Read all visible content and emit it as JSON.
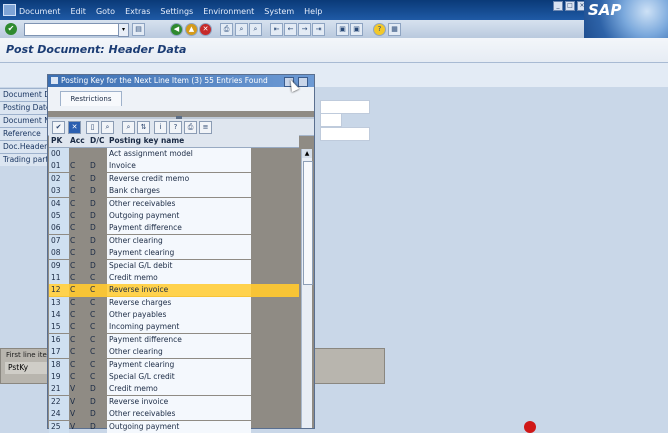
{
  "menu": {
    "items": [
      "Document",
      "Edit",
      "Goto",
      "Extras",
      "Settings",
      "Environment",
      "System",
      "Help"
    ],
    "logo": "SAP"
  },
  "toolbar": {
    "command_value": "",
    "icons": [
      "enter-icon",
      "save-icon",
      "back-icon",
      "exit-icon",
      "cancel-icon",
      "print-icon",
      "find-icon",
      "find-next-icon",
      "first-page-icon",
      "prev-page-icon",
      "next-page-icon",
      "last-page-icon",
      "new-session-icon",
      "shortcut-icon",
      "help-icon",
      "layout-icon"
    ]
  },
  "page": {
    "title": "Post Document: Header Data"
  },
  "header_labels": [
    "Document D",
    "Posting Date",
    "Document N",
    "Reference",
    "Doc.Header",
    "Trading part"
  ],
  "first_line": {
    "title": "First line ite",
    "pstky_label": "PstKy",
    "pstky_value": "1"
  },
  "dialog": {
    "title": "Posting Key for the Next Line Item (3)   55 Entries Found",
    "tab": "Restrictions",
    "columns": {
      "pk": "PK",
      "acc": "Acc",
      "dc": "D/C",
      "name": "Posting key name"
    },
    "selected_pk": "12",
    "rows": [
      {
        "pk": "00",
        "acc": "",
        "dc": "",
        "name": "Act assignment model"
      },
      {
        "pk": "01",
        "acc": "C",
        "dc": "D",
        "name": "Invoice"
      },
      {
        "pk": "02",
        "acc": "C",
        "dc": "D",
        "name": "Reverse credit memo"
      },
      {
        "pk": "03",
        "acc": "C",
        "dc": "D",
        "name": "Bank charges"
      },
      {
        "pk": "04",
        "acc": "C",
        "dc": "D",
        "name": "Other receivables"
      },
      {
        "pk": "05",
        "acc": "C",
        "dc": "D",
        "name": "Outgoing payment"
      },
      {
        "pk": "06",
        "acc": "C",
        "dc": "D",
        "name": "Payment difference"
      },
      {
        "pk": "07",
        "acc": "C",
        "dc": "D",
        "name": "Other clearing"
      },
      {
        "pk": "08",
        "acc": "C",
        "dc": "D",
        "name": "Payment clearing"
      },
      {
        "pk": "09",
        "acc": "C",
        "dc": "D",
        "name": "Special G/L debit"
      },
      {
        "pk": "11",
        "acc": "C",
        "dc": "C",
        "name": "Credit memo"
      },
      {
        "pk": "12",
        "acc": "C",
        "dc": "C",
        "name": "Reverse invoice"
      },
      {
        "pk": "13",
        "acc": "C",
        "dc": "C",
        "name": "Reverse charges"
      },
      {
        "pk": "14",
        "acc": "C",
        "dc": "C",
        "name": "Other payables"
      },
      {
        "pk": "15",
        "acc": "C",
        "dc": "C",
        "name": "Incoming payment"
      },
      {
        "pk": "16",
        "acc": "C",
        "dc": "C",
        "name": "Payment difference"
      },
      {
        "pk": "17",
        "acc": "C",
        "dc": "C",
        "name": "Other clearing"
      },
      {
        "pk": "18",
        "acc": "C",
        "dc": "C",
        "name": "Payment clearing"
      },
      {
        "pk": "19",
        "acc": "C",
        "dc": "C",
        "name": "Special G/L credit"
      },
      {
        "pk": "21",
        "acc": "V",
        "dc": "D",
        "name": "Credit memo"
      },
      {
        "pk": "22",
        "acc": "V",
        "dc": "D",
        "name": "Reverse invoice"
      },
      {
        "pk": "24",
        "acc": "V",
        "dc": "D",
        "name": "Other receivables"
      },
      {
        "pk": "25",
        "acc": "V",
        "dc": "D",
        "name": "Outgoing payment"
      }
    ]
  },
  "colors": {
    "menubar": "#1f5aa6",
    "selection": "#ffd24d",
    "title_text": "#1b3c74"
  }
}
